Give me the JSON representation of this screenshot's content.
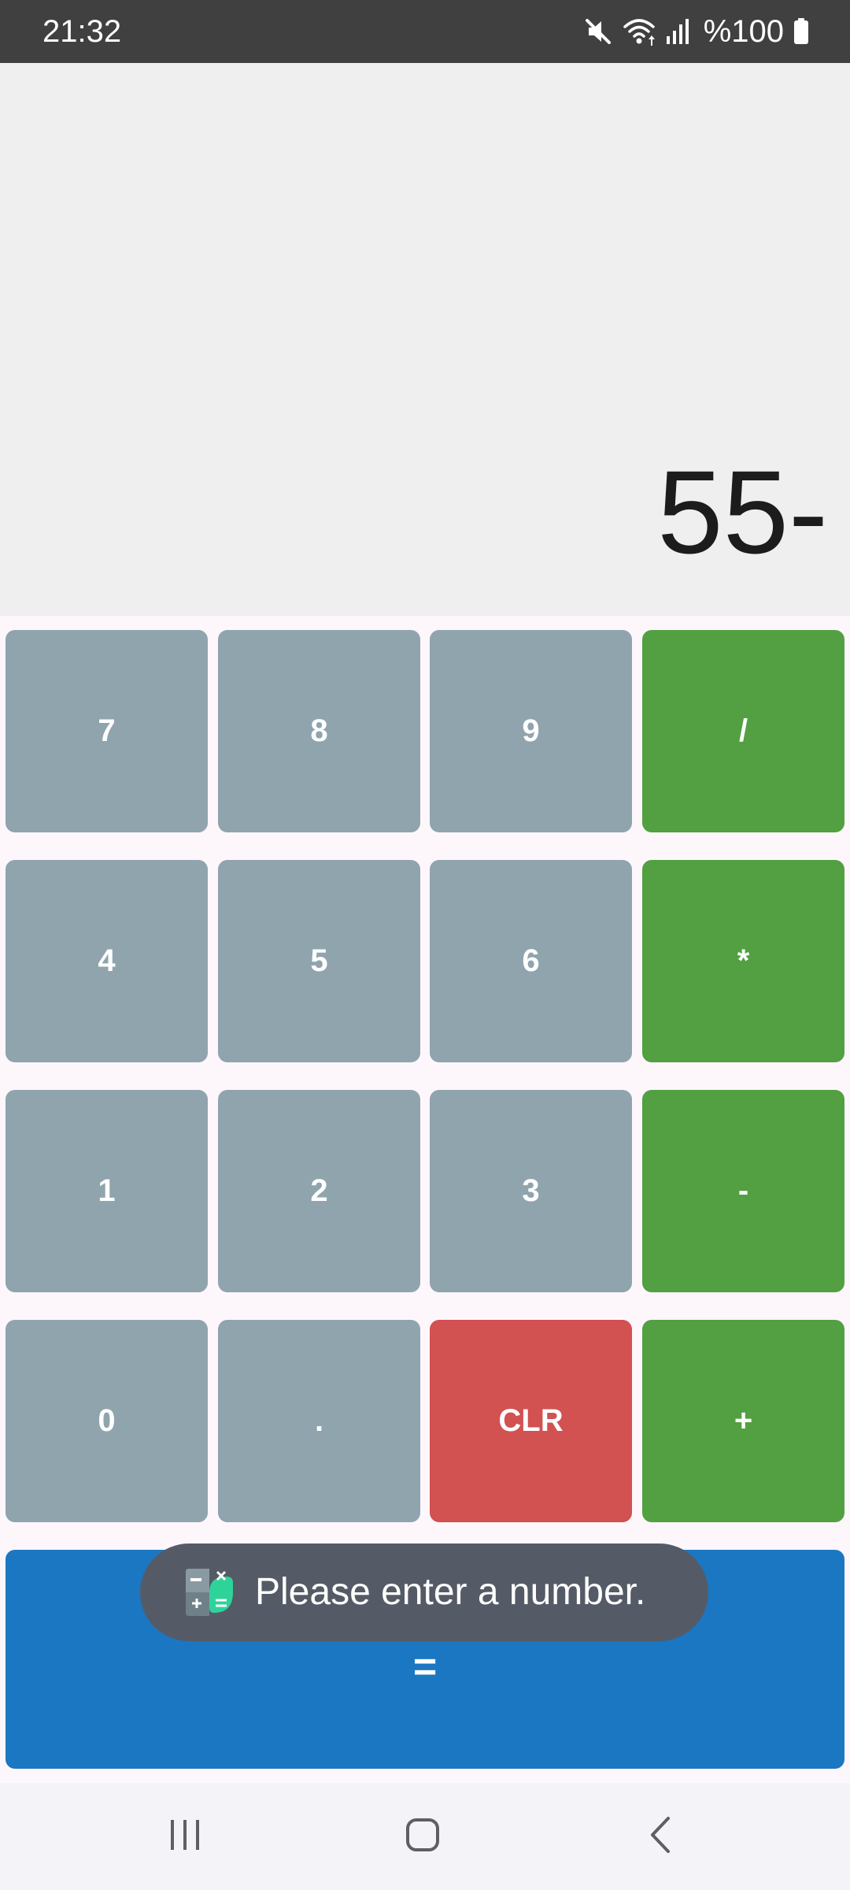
{
  "status_bar": {
    "time": "21:32",
    "battery": "%100",
    "icons": [
      "mute-icon",
      "wifi-icon",
      "signal-icon",
      "battery-icon"
    ]
  },
  "display": {
    "value": "55-"
  },
  "keypad": {
    "row1": [
      "7",
      "8",
      "9",
      "/"
    ],
    "row2": [
      "4",
      "5",
      "6",
      "*"
    ],
    "row3": [
      "1",
      "2",
      "3",
      "-"
    ],
    "row4": [
      "0",
      ".",
      "CLR",
      "+"
    ],
    "equals": "="
  },
  "toast": {
    "message": "Please enter a number.",
    "icon": "calculator-app-icon"
  },
  "nav_bar": {
    "buttons": [
      "recents-icon",
      "home-icon",
      "back-icon"
    ]
  },
  "colors": {
    "number_key": "#90a4ae",
    "operator_key": "#52a042",
    "clear_key": "#d25151",
    "equals_key": "#1b77c1",
    "display_bg": "#efefef",
    "status_bar": "#404040",
    "toast_bg": "#555b66"
  }
}
